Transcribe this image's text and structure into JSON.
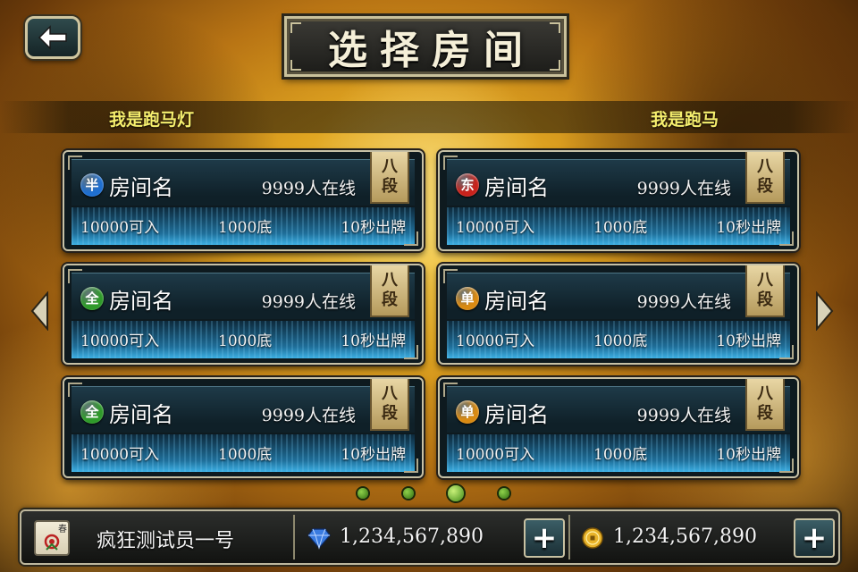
{
  "header": {
    "title": "选择房间",
    "back_icon": "back-arrow-icon"
  },
  "marquee": {
    "left_text": "我是跑马灯",
    "right_text": "我是跑马"
  },
  "rooms": [
    {
      "badge": "半",
      "badge_color": "#1f6fd0",
      "name": "房间名",
      "online": "9999人在线",
      "entry": "10000可入",
      "base": "1000底",
      "time": "10秒出牌",
      "rank": [
        "八",
        "段"
      ]
    },
    {
      "badge": "东",
      "badge_color": "#c8221c",
      "name": "房间名",
      "online": "9999人在线",
      "entry": "10000可入",
      "base": "1000底",
      "time": "10秒出牌",
      "rank": [
        "八",
        "段"
      ]
    },
    {
      "badge": "全",
      "badge_color": "#2f9a2a",
      "name": "房间名",
      "online": "9999人在线",
      "entry": "10000可入",
      "base": "1000底",
      "time": "10秒出牌",
      "rank": [
        "八",
        "段"
      ]
    },
    {
      "badge": "单",
      "badge_color": "#d98a12",
      "name": "房间名",
      "online": "9999人在线",
      "entry": "10000可入",
      "base": "1000底",
      "time": "10秒出牌",
      "rank": [
        "八",
        "段"
      ]
    },
    {
      "badge": "全",
      "badge_color": "#2f9a2a",
      "name": "房间名",
      "online": "9999人在线",
      "entry": "10000可入",
      "base": "1000底",
      "time": "10秒出牌",
      "rank": [
        "八",
        "段"
      ]
    },
    {
      "badge": "单",
      "badge_color": "#d98a12",
      "name": "房间名",
      "online": "9999人在线",
      "entry": "10000可入",
      "base": "1000底",
      "time": "10秒出牌",
      "rank": [
        "八",
        "段"
      ]
    }
  ],
  "pagination": {
    "pages": 4,
    "current_page": 3
  },
  "player": {
    "avatar_tile": "春",
    "name": "疯狂测试员一号",
    "diamonds": "1,234,567,890",
    "gold": "1,234,567,890",
    "diamond_icon": "diamond-icon",
    "gold_icon": "gold-coin-icon",
    "add_label": "+"
  }
}
